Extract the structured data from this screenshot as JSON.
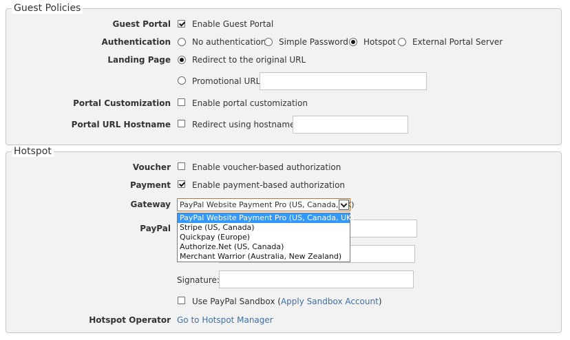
{
  "guest_policies": {
    "legend": "Guest Policies",
    "guest_portal": {
      "label": "Guest Portal",
      "option": "Enable Guest Portal",
      "checked": true
    },
    "authentication": {
      "label": "Authentication",
      "options": [
        "No authentication",
        "Simple Password",
        "Hotspot",
        "External Portal Server"
      ],
      "selected": "Hotspot"
    },
    "landing_page": {
      "label": "Landing Page",
      "options": [
        "Redirect to the original URL",
        "Promotional URL"
      ],
      "selected": "Redirect to the original URL",
      "promotional_url_value": ""
    },
    "portal_customization": {
      "label": "Portal Customization",
      "option": "Enable portal customization",
      "checked": false
    },
    "portal_url_hostname": {
      "label": "Portal URL Hostname",
      "option": "Redirect using hostname",
      "checked": false,
      "value": ""
    }
  },
  "hotspot": {
    "legend": "Hotspot",
    "voucher": {
      "label": "Voucher",
      "option": "Enable voucher-based authorization",
      "checked": false
    },
    "payment": {
      "label": "Payment",
      "option": "Enable payment-based authorization",
      "checked": true
    },
    "gateway": {
      "label": "Gateway",
      "selected": "PayPal Website Payment Pro (US, Canada, UK)",
      "options": [
        "PayPal Website Payment Pro (US, Canada, UK)",
        "Stripe (US, Canada)",
        "Quickpay (Europe)",
        "Authorize.Net (US, Canada)",
        "Merchant Warrior (Australia, New Zealand)"
      ]
    },
    "paypal": {
      "label": "PayPal",
      "signature_label": "Signature:",
      "sandbox_label": "Use PayPal Sandbox (",
      "sandbox_link": "Apply Sandbox Account",
      "sandbox_close": ")",
      "sandbox_checked": false
    },
    "hotspot_operator": {
      "label": "Hotspot Operator",
      "link": "Go to Hotspot Manager"
    }
  },
  "colors": {
    "link": "#3d6fa6",
    "dropdown_highlight": "#3399ff"
  }
}
